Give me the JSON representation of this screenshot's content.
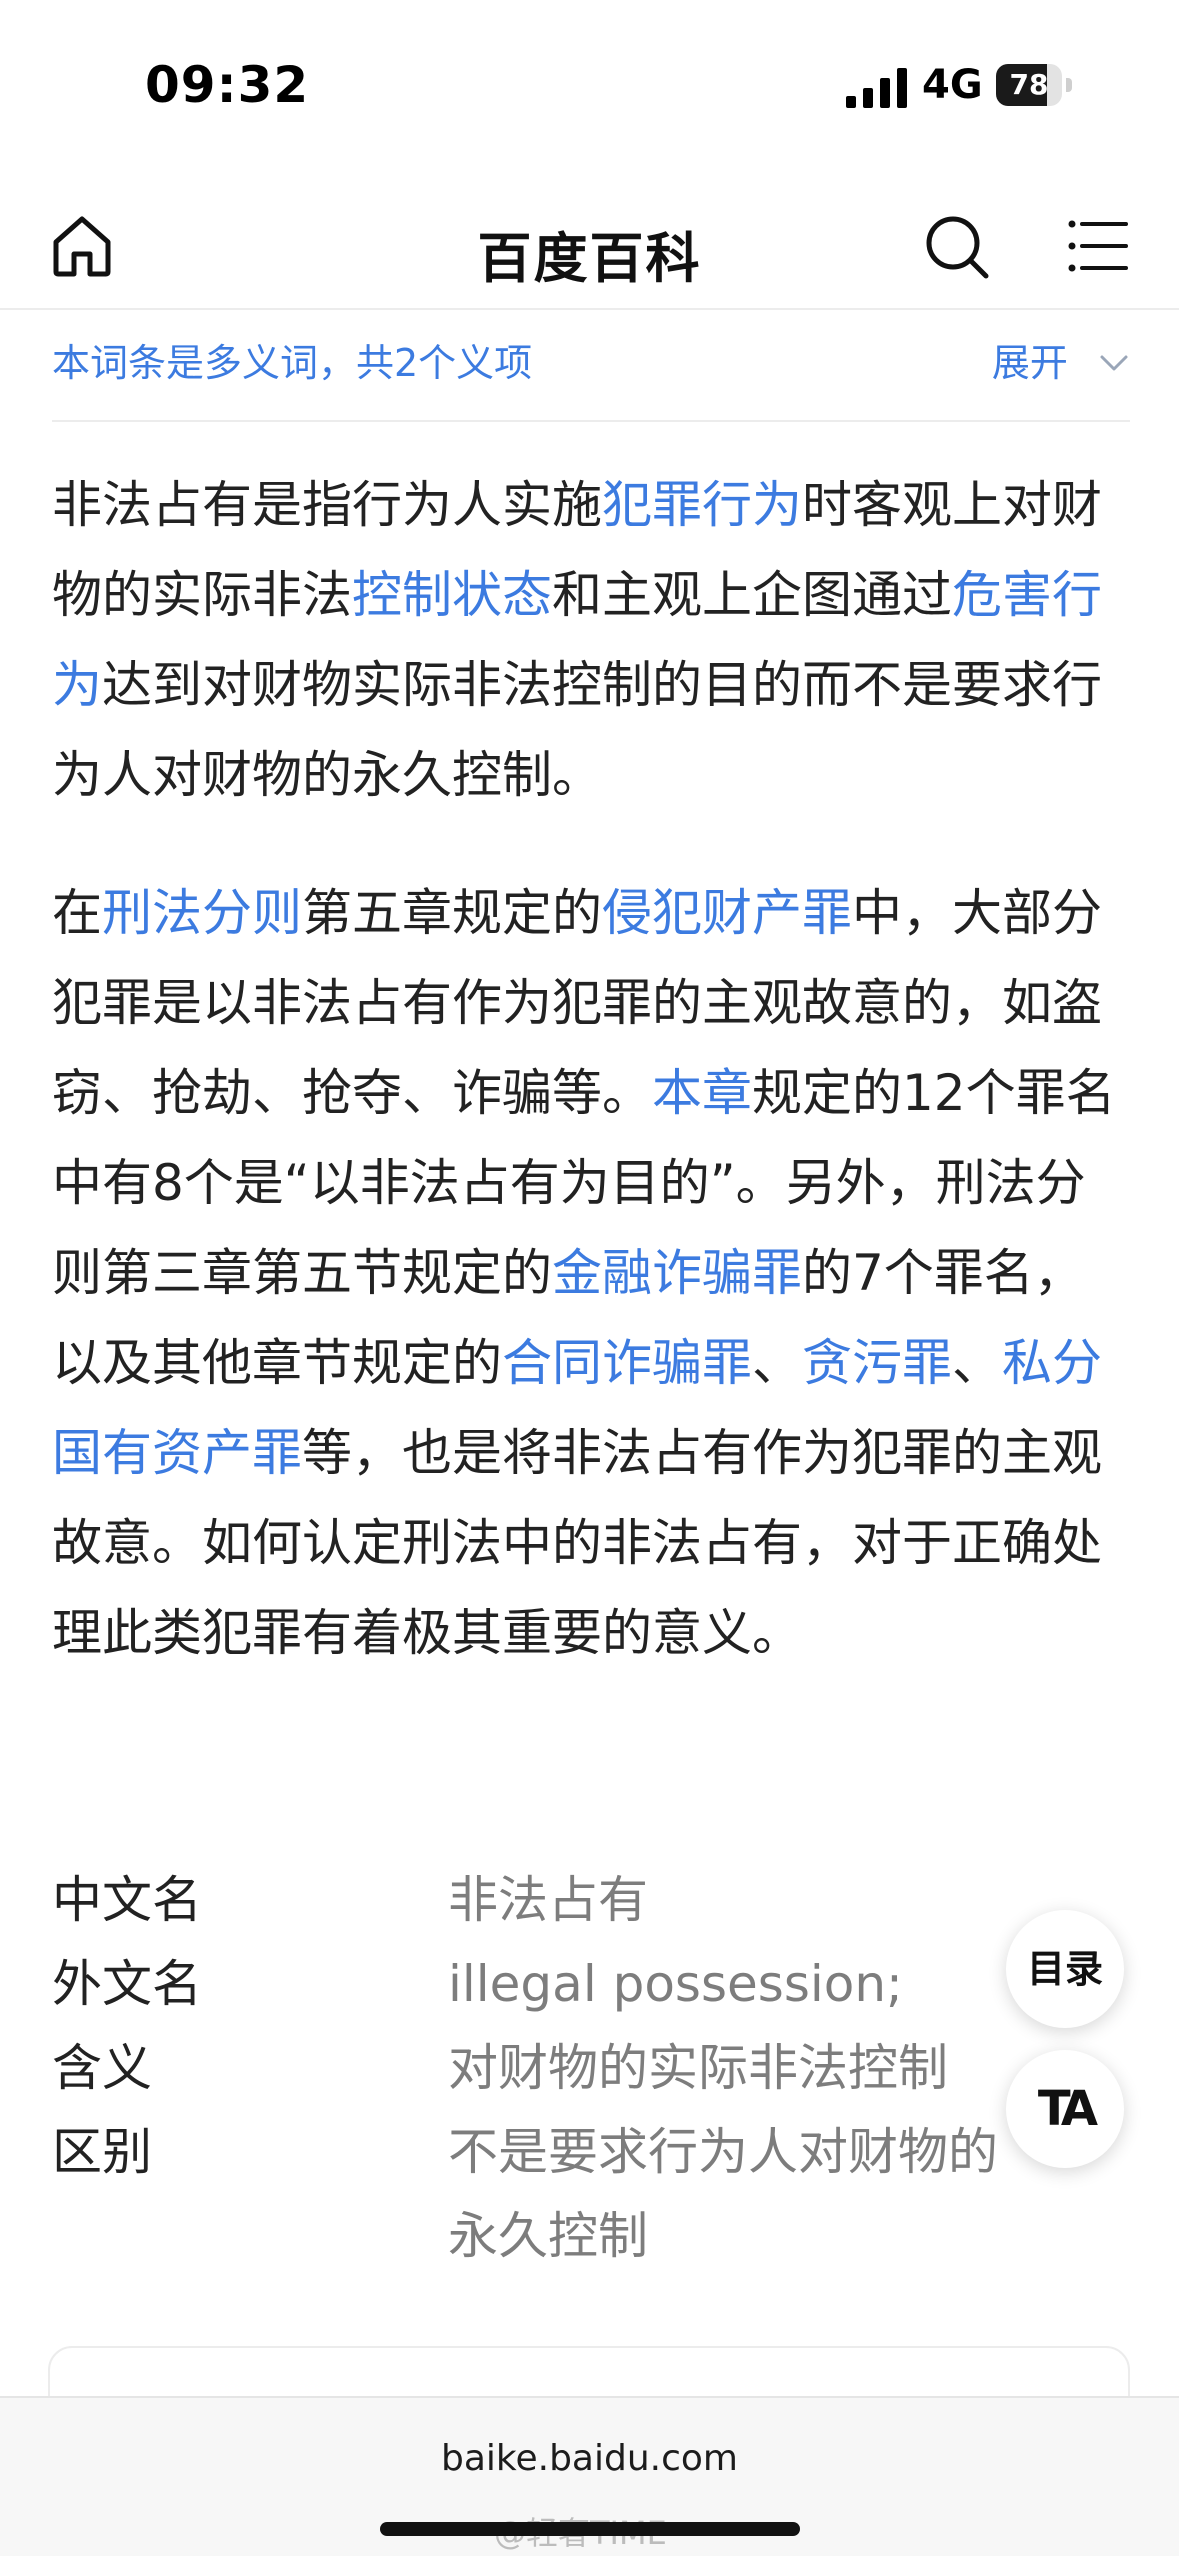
{
  "status_bar": {
    "time": "09:32",
    "network": "4G",
    "battery_level": "78",
    "battery_fraction": 0.78
  },
  "header": {
    "title": "百度百科",
    "icons": [
      "home-icon",
      "search-icon",
      "menu-icon"
    ]
  },
  "disambiguation": {
    "text": "本词条是多义词，共2个义项",
    "expand_label": "展开"
  },
  "paragraph1": [
    {
      "text": "非法占有是指行为人实施",
      "link": false
    },
    {
      "text": "犯罪行为",
      "link": true
    },
    {
      "text": "时客观上对财物的实际非法",
      "link": false
    },
    {
      "text": "控制状态",
      "link": true
    },
    {
      "text": "和主观上企图通过",
      "link": false
    },
    {
      "text": "危害行为",
      "link": true
    },
    {
      "text": "达到对财物实际非法控制的目的而不是要求行为人对财物的永久控制。",
      "link": false
    }
  ],
  "paragraph2": [
    {
      "text": "在",
      "link": false
    },
    {
      "text": "刑法分则",
      "link": true
    },
    {
      "text": "第五章规定的",
      "link": false
    },
    {
      "text": "侵犯财产罪",
      "link": true
    },
    {
      "text": "中，大部分犯罪是以非法占有作为犯罪的主观故意的，如盗窃、抢劫、抢夺、诈骗等。",
      "link": false
    },
    {
      "text": "本章",
      "link": true
    },
    {
      "text": "规定的12个罪名中有8个是“以非法占有为目的”。另外，刑法分则第三章第五节规定的",
      "link": false
    },
    {
      "text": "金融诈骗罪",
      "link": true
    },
    {
      "text": "的7个罪名，以及其他章节规定的",
      "link": false
    },
    {
      "text": "合同诈骗罪",
      "link": true
    },
    {
      "text": "、",
      "link": false
    },
    {
      "text": "贪污罪",
      "link": true
    },
    {
      "text": "、",
      "link": false
    },
    {
      "text": "私分国有资产罪",
      "link": true
    },
    {
      "text": "等，也是将非法占有作为犯罪的主观故意。如何认定刑法中的非法占有，对于正确处理此类犯罪有着极其重要的意义。",
      "link": false
    }
  ],
  "info_table": [
    {
      "label": "中文名",
      "value": "非法占有"
    },
    {
      "label": "外文名",
      "value": "illegal possession;"
    },
    {
      "label": "含义",
      "value": "对财物的实际非法控制"
    },
    {
      "label": "区别",
      "value": "不是要求行为人对财物的永久控制"
    }
  ],
  "floating_buttons": {
    "toc_label": "目录",
    "text_size_label": "TA"
  },
  "bottom_bar": {
    "url": "baike.baidu.com",
    "watermark": "@轻奢TIME"
  }
}
